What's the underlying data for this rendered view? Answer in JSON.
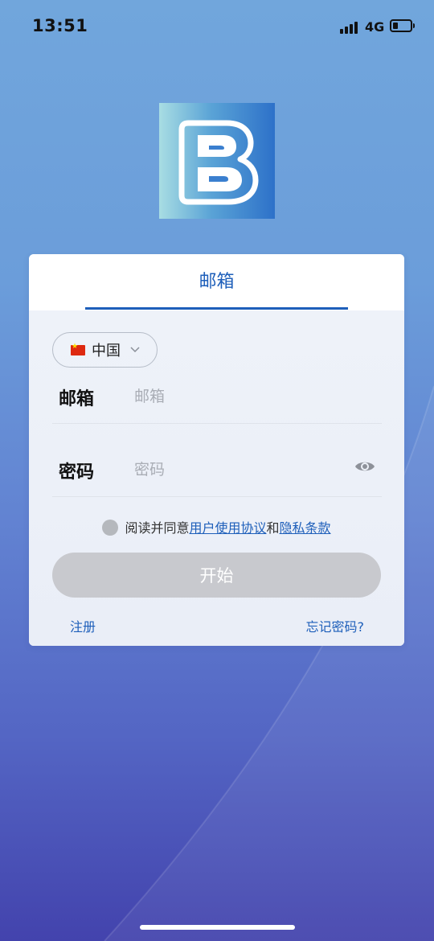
{
  "status_bar": {
    "time": "13:51",
    "network": "4G",
    "battery_level": 0.3
  },
  "card": {
    "tab_label": "邮箱",
    "country": {
      "flag": "china-flag-icon",
      "label": "中国"
    },
    "email_field": {
      "label": "邮箱",
      "placeholder": "邮箱",
      "value": ""
    },
    "password_field": {
      "label": "密码",
      "placeholder": "密码",
      "value": ""
    },
    "agreement": {
      "prefix": "阅读并同意",
      "terms_link": "用户使用协议",
      "conjunction": "和",
      "privacy_link": "隐私条款",
      "checked": false
    },
    "start_button": "开始",
    "register_link": "注册",
    "forgot_link": "忘记密码?"
  },
  "colors": {
    "accent": "#1e5fba",
    "button_disabled": "#c8c9ce"
  }
}
